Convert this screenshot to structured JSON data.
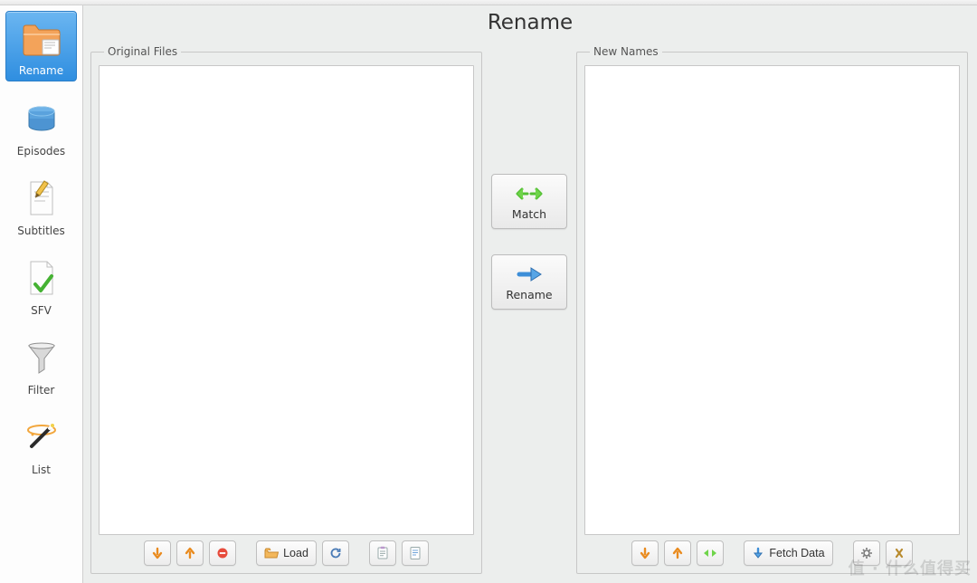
{
  "window": {
    "title": "Rename"
  },
  "sidebar": {
    "items": [
      {
        "label": "Rename",
        "icon": "folder-rename-icon",
        "selected": true
      },
      {
        "label": "Episodes",
        "icon": "stack-icon"
      },
      {
        "label": "Subtitles",
        "icon": "document-pencil-icon"
      },
      {
        "label": "SFV",
        "icon": "document-check-icon"
      },
      {
        "label": "Filter",
        "icon": "funnel-icon"
      },
      {
        "label": "List",
        "icon": "wand-icon"
      }
    ]
  },
  "panels": {
    "original": {
      "legend": "Original Files",
      "toolbar": {
        "down_tip": "Move Down",
        "up_tip": "Move Up",
        "remove_tip": "Remove",
        "load_label": "Load",
        "refresh_tip": "Refresh",
        "clipboard_tip": "Send to Clipboard",
        "history_tip": "Open History"
      }
    },
    "new": {
      "legend": "New Names",
      "toolbar": {
        "down_tip": "Move Down",
        "up_tip": "Move Up",
        "match_tip": "Auto-Align",
        "fetch_label": "Fetch Data",
        "settings_tip": "Preferences",
        "swap_tip": "Swap"
      }
    }
  },
  "center": {
    "match_label": "Match",
    "rename_label": "Rename"
  },
  "watermark": "值 · 什么值得买"
}
